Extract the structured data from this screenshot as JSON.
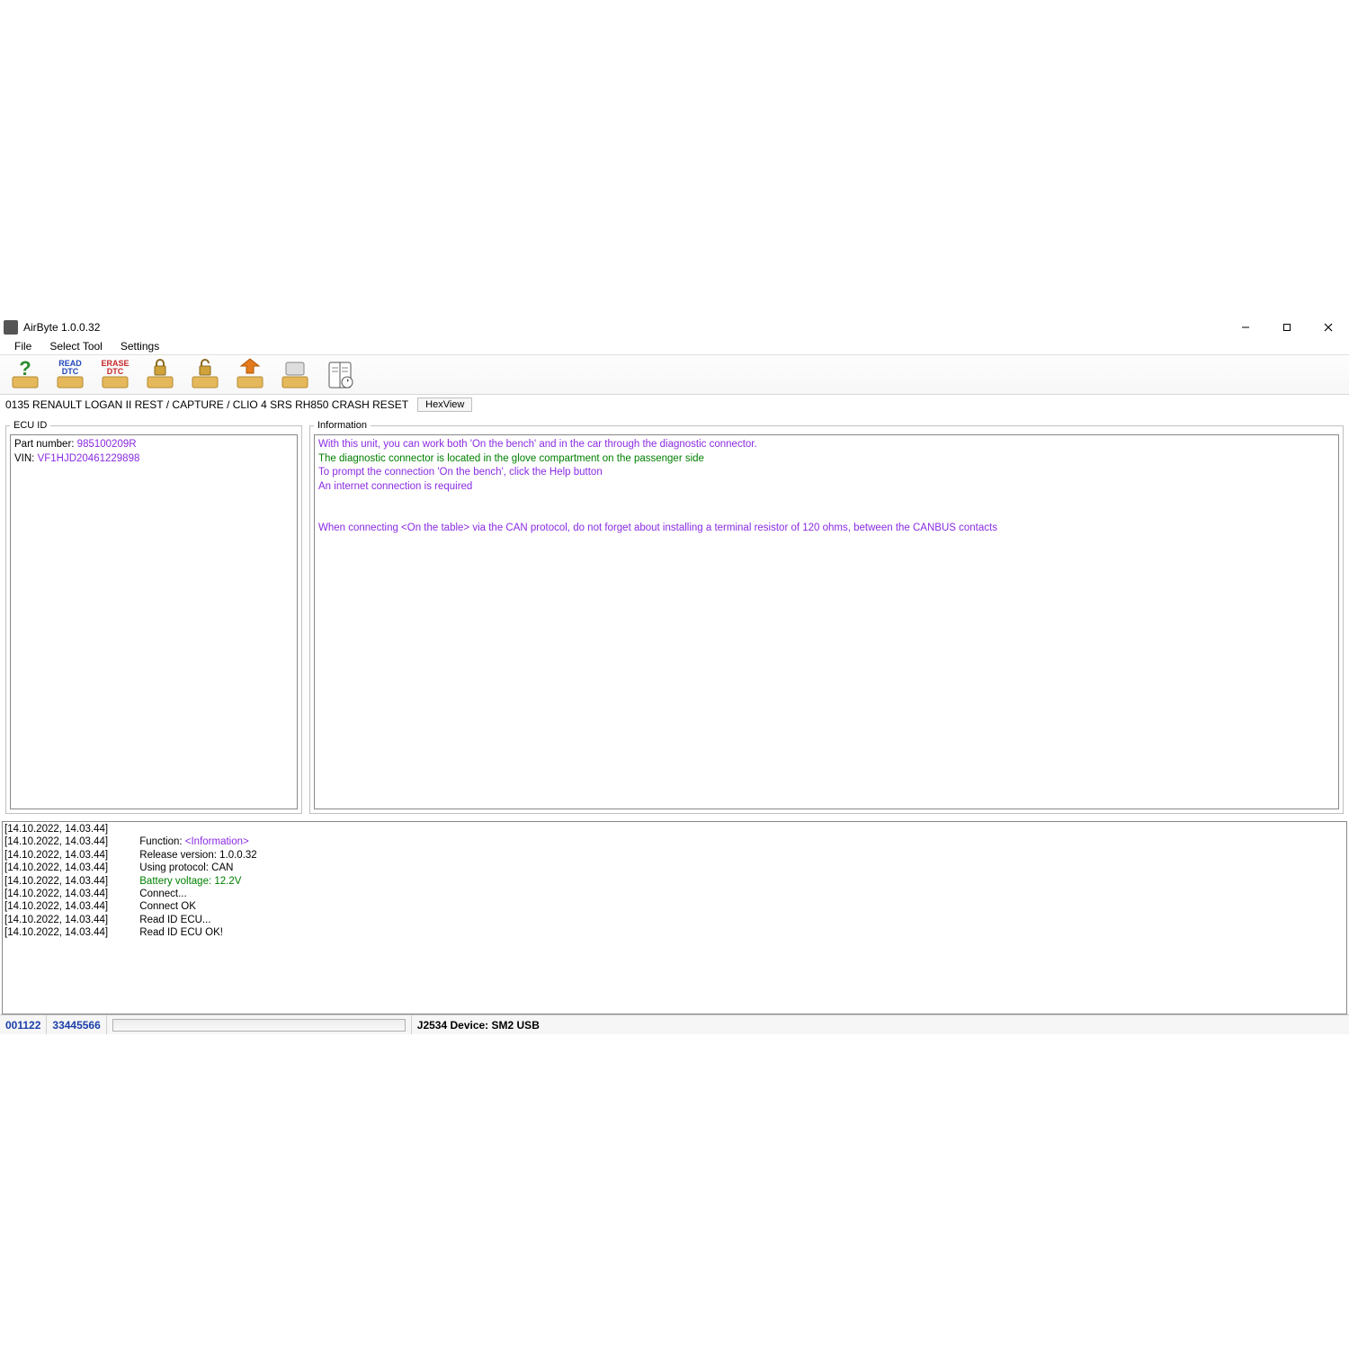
{
  "window": {
    "title": "AirByte 1.0.0.32"
  },
  "menu": {
    "file": "File",
    "select_tool": "Select Tool",
    "settings": "Settings"
  },
  "toolbar": {
    "help": "?",
    "read_dtc_l1": "READ",
    "read_dtc_l2": "DTC",
    "erase_dtc_l1": "ERASE",
    "erase_dtc_l2": "DTC"
  },
  "context": {
    "path": "0135 RENAULT LOGAN II REST / CAPTURE / CLIO 4 SRS RH850 CRASH RESET",
    "hexview": "HexView"
  },
  "ecu": {
    "title": "ECU ID",
    "part_label": "Part number: ",
    "part_value": "985100209R",
    "vin_label": "VIN: ",
    "vin_value": "VF1HJD20461229898"
  },
  "info": {
    "title": "Information",
    "l1": "With this unit, you can work both 'On the bench' and in the car through the diagnostic connector.",
    "l2": "The diagnostic connector is located in the glove compartment on the passenger side",
    "l3": "To prompt the connection 'On the bench', click the Help button",
    "l4": "An internet connection is required",
    "l5": "When connecting <On the table> via the CAN protocol, do not forget about installing a terminal resistor of 120 ohms, between the CANBUS contacts"
  },
  "log": {
    "ts": "[14.10.2022, 14.03.44]",
    "r0_a": "Function: ",
    "r0_b": "<Information>",
    "r1": "Release version: 1.0.0.32",
    "r2": "Using protocol: CAN",
    "r3_a": "Battery voltage: ",
    "r3_b": "12.2V",
    "r4": "Connect...",
    "r5": "Connect OK",
    "r6": "Read ID ECU...",
    "r7": "Read ID ECU OK!"
  },
  "status": {
    "code1": "001122",
    "code2": "33445566",
    "device": "J2534 Device: SM2 USB"
  }
}
